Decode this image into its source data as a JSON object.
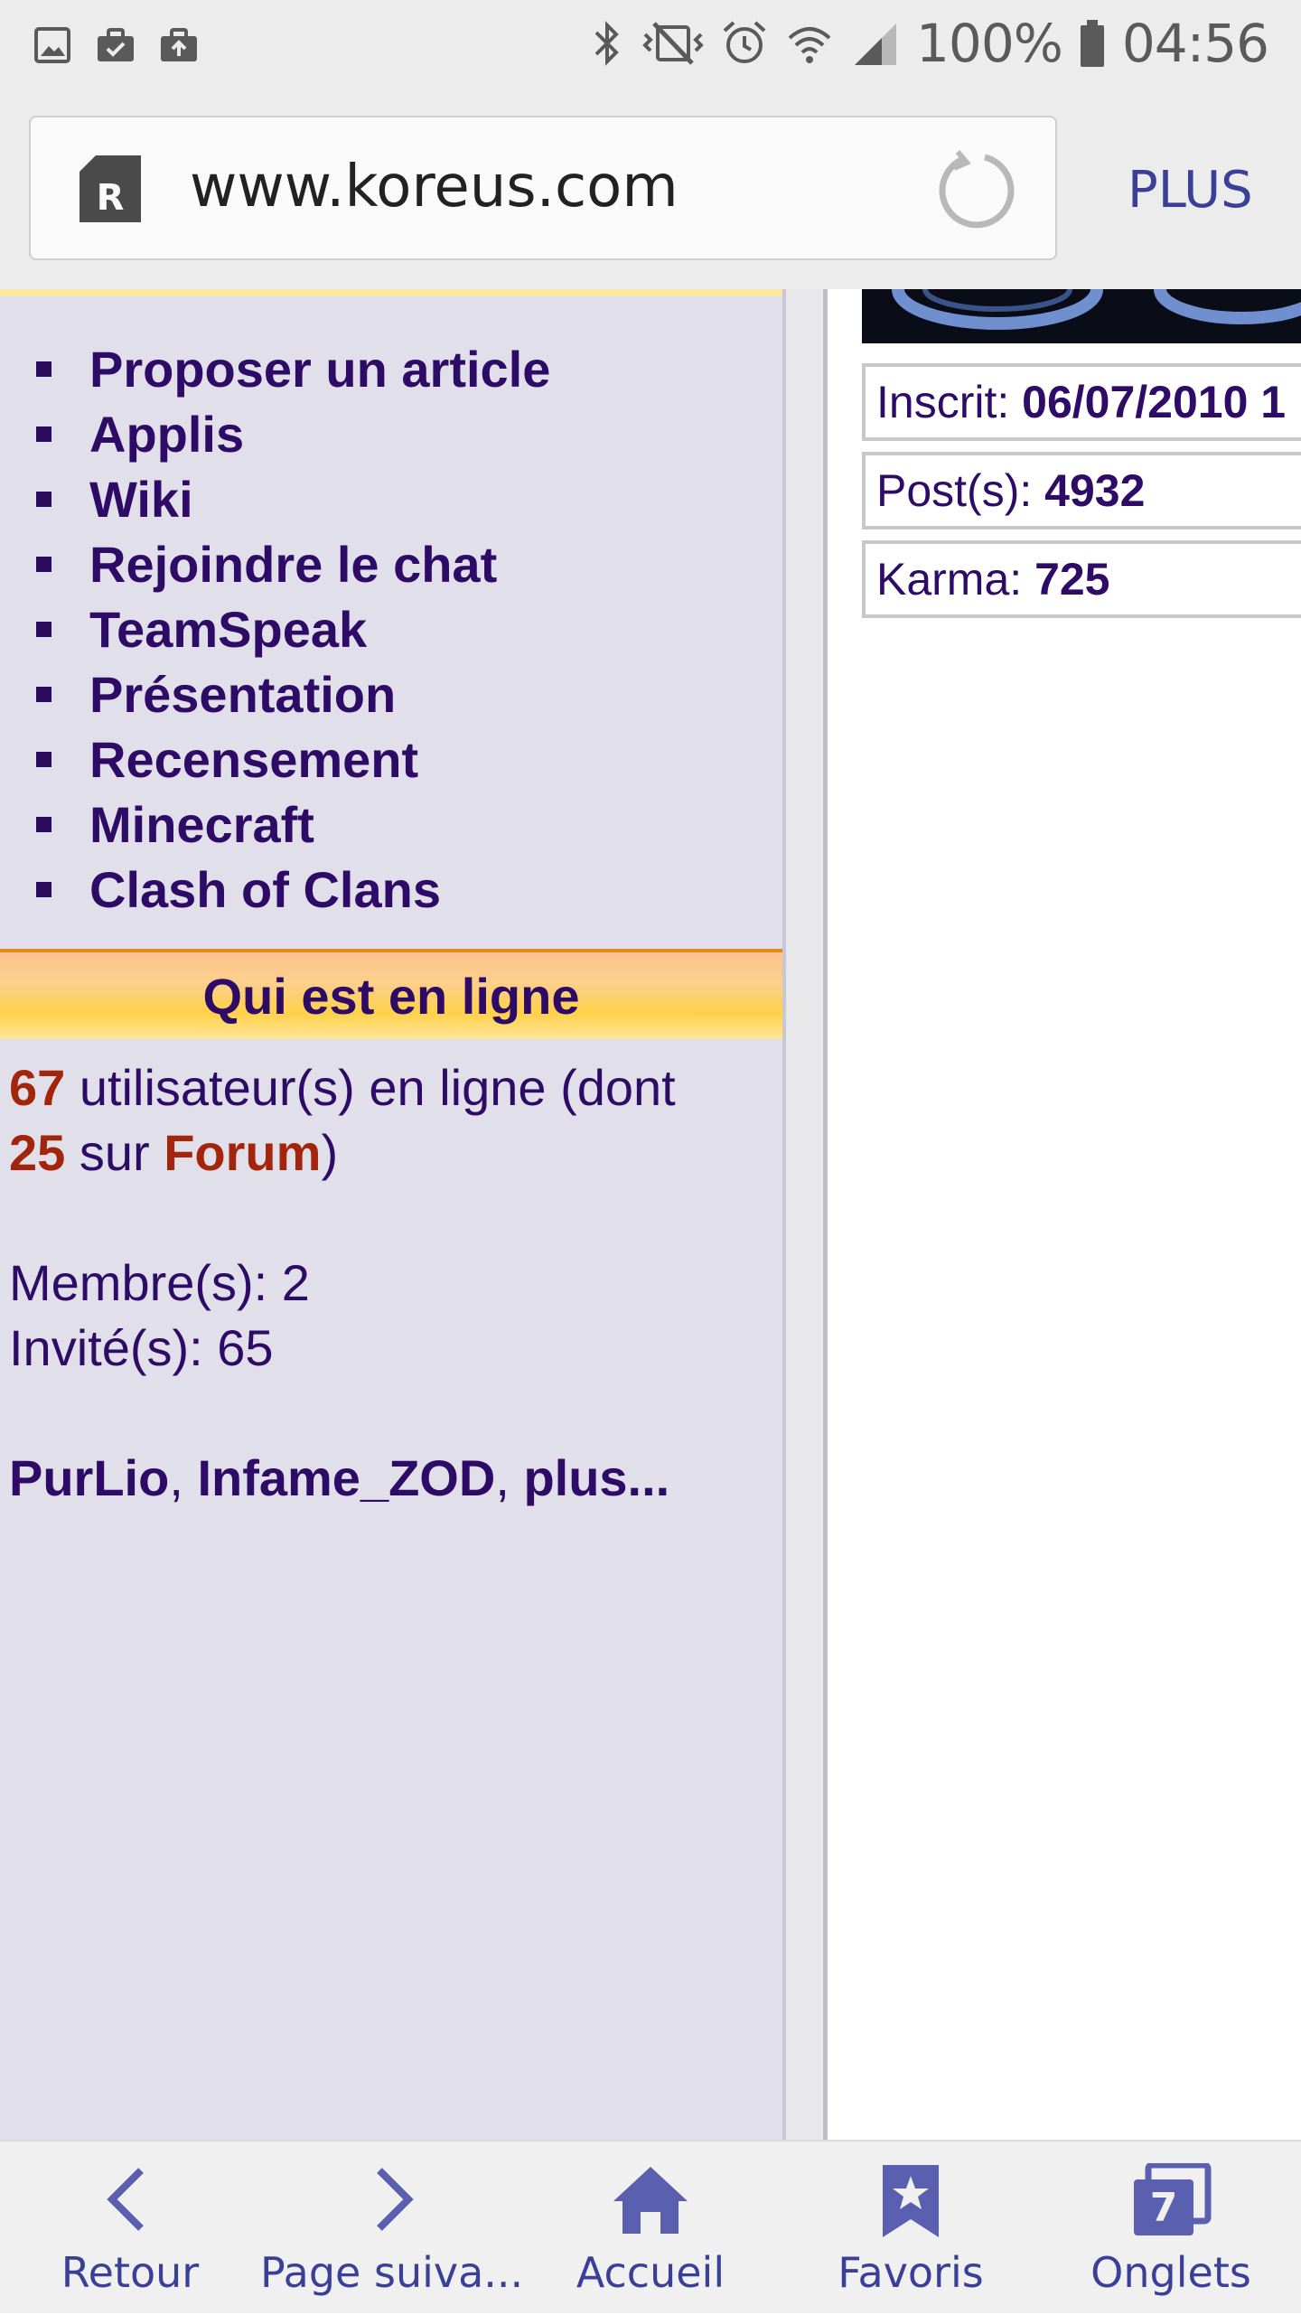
{
  "status_bar": {
    "battery": "100%",
    "time": "04:56",
    "left_icons": [
      "image-icon",
      "briefcase-check-icon",
      "briefcase-upload-icon"
    ],
    "right_icons": [
      "bluetooth-icon",
      "vibrate-off-icon",
      "alarm-icon",
      "wifi-icon",
      "signal-icon",
      "battery-icon"
    ]
  },
  "browser": {
    "url": "www.koreus.com",
    "plus_label": "PLUS"
  },
  "menu": {
    "items": [
      "Proposer un article",
      "Applis",
      "Wiki",
      "Rejoindre le chat",
      "TeamSpeak",
      "Présentation",
      "Recensement",
      "Minecraft",
      "Clash of Clans"
    ]
  },
  "online": {
    "header": "Qui est en ligne",
    "users_count": "67",
    "users_text": " utilisateur(s) en ligne (dont",
    "forum_count": "25",
    "forum_text_pre": " sur ",
    "forum_link": "Forum",
    "forum_text_post": ")",
    "members": "Membre(s): 2",
    "guests": "Invité(s): 65",
    "names": [
      "PurLio",
      "Infame_ZOD",
      "plus..."
    ],
    "separator": ", "
  },
  "profile": {
    "registered_label": "Inscrit: ",
    "registered_value": "06/07/2010 1",
    "posts_label": "Post(s): ",
    "posts_value": "4932",
    "karma_label": "Karma: ",
    "karma_value": "725"
  },
  "bottom_nav": {
    "back": "Retour",
    "forward": "Page suiva...",
    "home": "Accueil",
    "bookmarks": "Favoris",
    "tabs": "Onglets",
    "tabs_count": "7"
  },
  "colors": {
    "link": "#2e0b66",
    "highlight": "#a3250c",
    "nav": "#3a3f97",
    "header_orange": "#ffd14a"
  }
}
